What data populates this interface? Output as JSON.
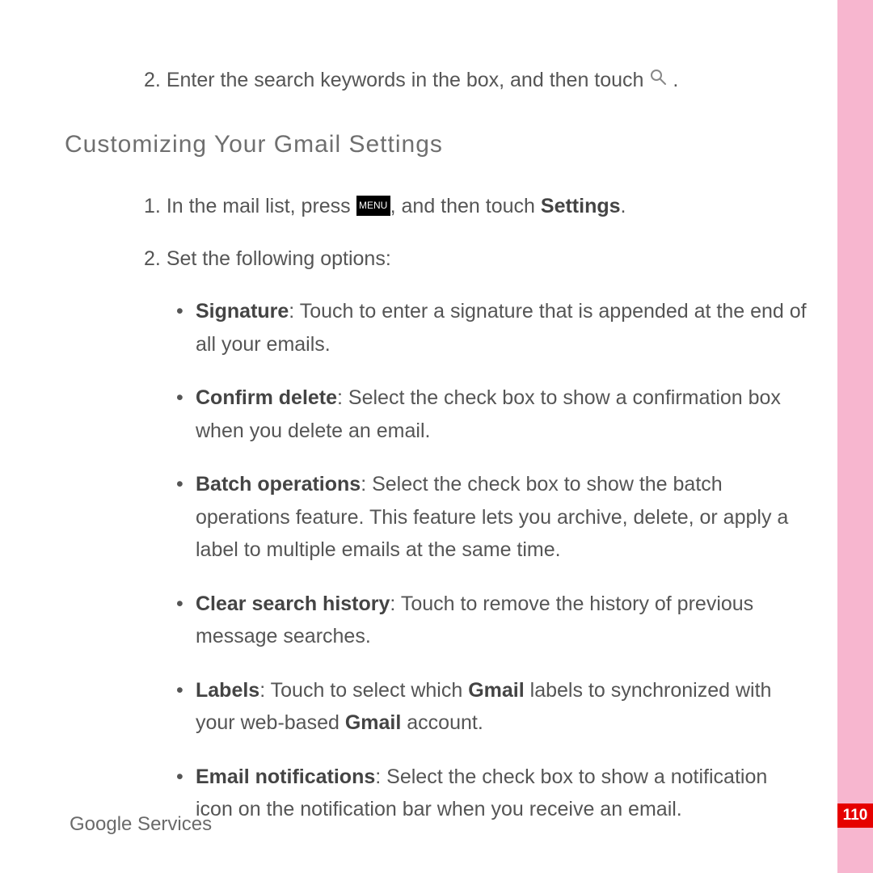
{
  "intro_step": {
    "num": "2.",
    "text_before": "Enter the search keywords in the box, and then touch ",
    "text_after": "."
  },
  "heading": "Customizing Your Gmail Settings",
  "step1": {
    "num": "1.",
    "before_key": "In the mail list, press ",
    "menu_label": "MENU",
    "after_key": ", and then touch ",
    "settings_label": "Settings",
    "tail": "."
  },
  "step2": {
    "num": "2.",
    "text": "Set the following options:"
  },
  "options": [
    {
      "label": "Signature",
      "text": ": Touch to enter a signature that is appended at the end of all your emails."
    },
    {
      "label": "Confirm delete",
      "text": ": Select the check box to show a confirmation box when you delete an email."
    },
    {
      "label": "Batch operations",
      "text": ": Select the check box to show the batch operations feature. This feature lets you archive, delete, or apply a label to multiple emails at the same time."
    },
    {
      "label": "Clear search history",
      "text": ": Touch to remove the history of previous message searches."
    }
  ],
  "labels_option": {
    "label": "Labels",
    "p1": ": Touch to select which ",
    "gmail1": "Gmail",
    "p2": " labels to synchronized with your web-based ",
    "gmail2": "Gmail",
    "p3": " account."
  },
  "email_notif": {
    "label": "Email notifications",
    "text": ": Select the check box to show a notification icon on the notification bar when you receive an email."
  },
  "footer": "Google Services",
  "page_number": "110"
}
